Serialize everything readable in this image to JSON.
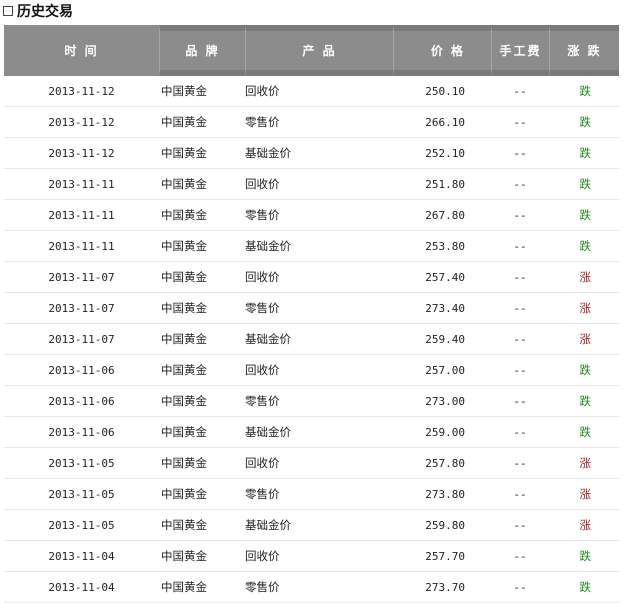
{
  "section": {
    "title": "历史交易"
  },
  "table": {
    "headers": {
      "date": "时 间",
      "brand": "品 牌",
      "product": "产 品",
      "price": "价 格",
      "fee": "手工费",
      "trend": "涨 跌"
    },
    "rows": [
      {
        "date": "2013-11-12",
        "brand": "中国黄金",
        "product": "回收价",
        "price": "250.10",
        "fee": "--",
        "trend": "跌",
        "dir": "down"
      },
      {
        "date": "2013-11-12",
        "brand": "中国黄金",
        "product": "零售价",
        "price": "266.10",
        "fee": "--",
        "trend": "跌",
        "dir": "down"
      },
      {
        "date": "2013-11-12",
        "brand": "中国黄金",
        "product": "基础金价",
        "price": "252.10",
        "fee": "--",
        "trend": "跌",
        "dir": "down"
      },
      {
        "date": "2013-11-11",
        "brand": "中国黄金",
        "product": "回收价",
        "price": "251.80",
        "fee": "--",
        "trend": "跌",
        "dir": "down"
      },
      {
        "date": "2013-11-11",
        "brand": "中国黄金",
        "product": "零售价",
        "price": "267.80",
        "fee": "--",
        "trend": "跌",
        "dir": "down"
      },
      {
        "date": "2013-11-11",
        "brand": "中国黄金",
        "product": "基础金价",
        "price": "253.80",
        "fee": "--",
        "trend": "跌",
        "dir": "down"
      },
      {
        "date": "2013-11-07",
        "brand": "中国黄金",
        "product": "回收价",
        "price": "257.40",
        "fee": "--",
        "trend": "涨",
        "dir": "up"
      },
      {
        "date": "2013-11-07",
        "brand": "中国黄金",
        "product": "零售价",
        "price": "273.40",
        "fee": "--",
        "trend": "涨",
        "dir": "up"
      },
      {
        "date": "2013-11-07",
        "brand": "中国黄金",
        "product": "基础金价",
        "price": "259.40",
        "fee": "--",
        "trend": "涨",
        "dir": "up"
      },
      {
        "date": "2013-11-06",
        "brand": "中国黄金",
        "product": "回收价",
        "price": "257.00",
        "fee": "--",
        "trend": "跌",
        "dir": "down"
      },
      {
        "date": "2013-11-06",
        "brand": "中国黄金",
        "product": "零售价",
        "price": "273.00",
        "fee": "--",
        "trend": "跌",
        "dir": "down"
      },
      {
        "date": "2013-11-06",
        "brand": "中国黄金",
        "product": "基础金价",
        "price": "259.00",
        "fee": "--",
        "trend": "跌",
        "dir": "down"
      },
      {
        "date": "2013-11-05",
        "brand": "中国黄金",
        "product": "回收价",
        "price": "257.80",
        "fee": "--",
        "trend": "涨",
        "dir": "up"
      },
      {
        "date": "2013-11-05",
        "brand": "中国黄金",
        "product": "零售价",
        "price": "273.80",
        "fee": "--",
        "trend": "涨",
        "dir": "up"
      },
      {
        "date": "2013-11-05",
        "brand": "中国黄金",
        "product": "基础金价",
        "price": "259.80",
        "fee": "--",
        "trend": "涨",
        "dir": "up"
      },
      {
        "date": "2013-11-04",
        "brand": "中国黄金",
        "product": "回收价",
        "price": "257.70",
        "fee": "--",
        "trend": "跌",
        "dir": "down"
      },
      {
        "date": "2013-11-04",
        "brand": "中国黄金",
        "product": "零售价",
        "price": "273.70",
        "fee": "--",
        "trend": "跌",
        "dir": "down"
      }
    ]
  },
  "colors": {
    "header_bg": "#8c8c8c",
    "up": "#a02020",
    "down": "#1a8a1a"
  }
}
